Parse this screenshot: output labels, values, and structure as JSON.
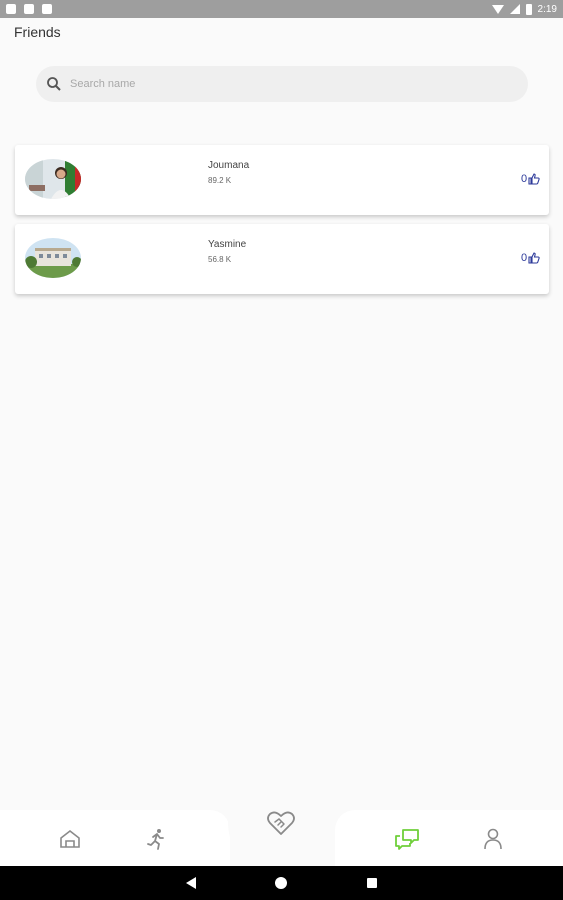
{
  "status_bar": {
    "time": "2:19"
  },
  "header": {
    "title": "Friends"
  },
  "search": {
    "placeholder": "Search name",
    "value": ""
  },
  "friends": [
    {
      "name": "Joumana",
      "score": "89.2 K",
      "likes": "0"
    },
    {
      "name": "Yasmine",
      "score": "56.8 K",
      "likes": "0"
    }
  ],
  "bottom_nav": {
    "items": [
      "home-icon",
      "run-icon",
      "handshake-heart-icon",
      "chat-icon",
      "person-icon"
    ],
    "active": "chat-icon"
  },
  "colors": {
    "accent": "#6fcf3a",
    "like": "#2d3a9a",
    "nav_icon": "#8a8a8a"
  }
}
